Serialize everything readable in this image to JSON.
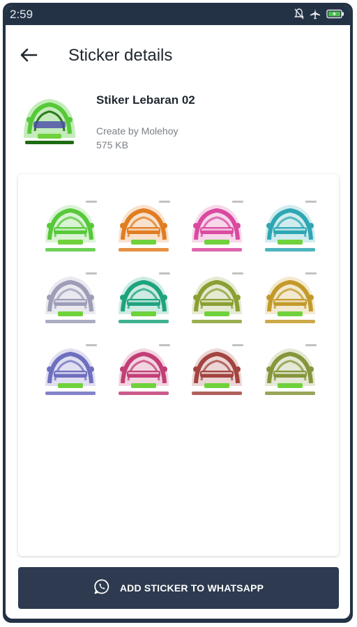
{
  "status_bar": {
    "time": "2:59",
    "icons": [
      "bell-off-icon",
      "airplane-icon",
      "battery-charging-icon"
    ],
    "accent_color": "#233245"
  },
  "header": {
    "back_icon": "arrow-left-icon",
    "title": "Sticker details"
  },
  "pack": {
    "name": "Stiker Lebaran 02",
    "author": "Create by Molehoy",
    "size": "575 KB",
    "thumbnail_color": "#57c83a"
  },
  "stickers": [
    {
      "color": "#57c83a"
    },
    {
      "color": "#e07d22"
    },
    {
      "color": "#d94aa0"
    },
    {
      "color": "#2ea7b3"
    },
    {
      "color": "#9d9db8"
    },
    {
      "color": "#1fa37e"
    },
    {
      "color": "#8aa033"
    },
    {
      "color": "#c39a2a"
    },
    {
      "color": "#6f6fbf"
    },
    {
      "color": "#c23e76"
    },
    {
      "color": "#a2443f"
    },
    {
      "color": "#85963b"
    }
  ],
  "add_button": {
    "label": "ADD STICKER TO WHATSAPP",
    "icon": "whatsapp-icon",
    "color": "#2d3a4f"
  }
}
